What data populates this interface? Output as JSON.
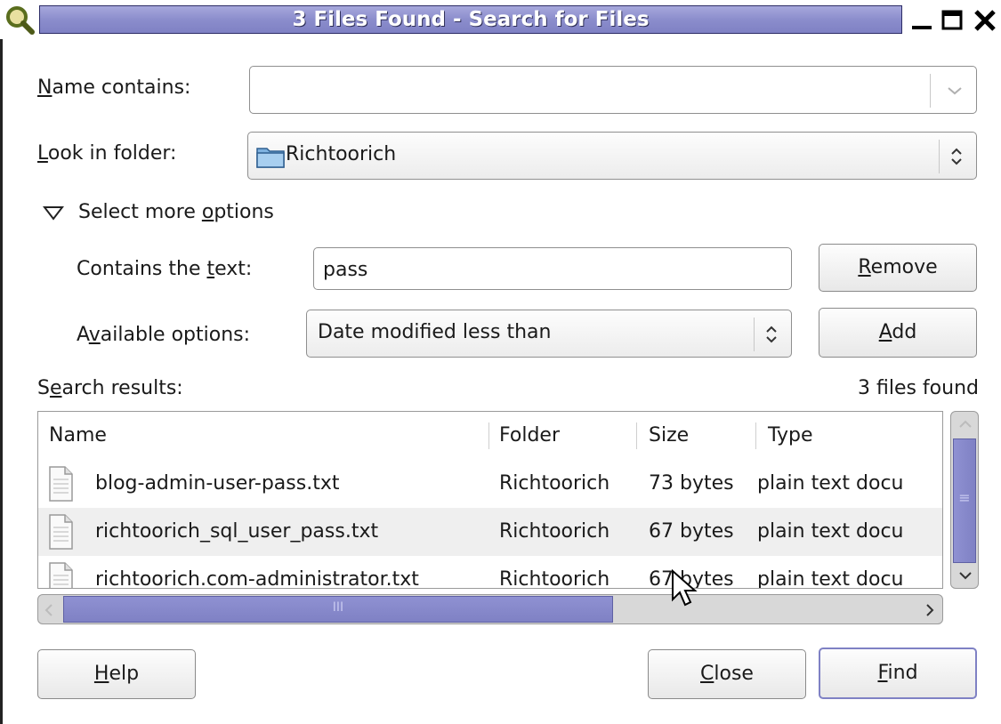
{
  "window": {
    "title": "3 Files Found - Search for Files",
    "app_icon": "magnifier-icon",
    "controls": [
      "minimize-icon",
      "maximize-icon",
      "close-icon"
    ]
  },
  "name_contains": {
    "label": "Name contains:",
    "mnemonic": "N",
    "rest": "ame contains:",
    "value": ""
  },
  "look_in": {
    "label_prefix": "",
    "mnemonic": "L",
    "rest": "ook in folder:",
    "value": "Richtoorich",
    "icon": "folder-icon"
  },
  "more_options": {
    "label_prefix": "Select more ",
    "mnemonic": "o",
    "rest": "ptions",
    "expanded": true
  },
  "contains_text": {
    "prefix": "Contains the ",
    "mnemonic": "t",
    "rest": "ext:",
    "value": "pass"
  },
  "available_options": {
    "prefix": "A",
    "mnemonic": "v",
    "rest": "ailable options:",
    "selected": "Date modified less than"
  },
  "buttons": {
    "remove": {
      "mnemonic": "R",
      "rest": "emove"
    },
    "add": {
      "mnemonic": "A",
      "rest": "dd"
    },
    "help": {
      "mnemonic": "H",
      "rest": "elp"
    },
    "close": {
      "mnemonic": "C",
      "rest": "lose"
    },
    "find": {
      "mnemonic": "F",
      "rest": "ind"
    }
  },
  "results": {
    "label_prefix": "S",
    "mnemonic": "e",
    "rest": "arch results:",
    "count_text": "3 files found",
    "columns": [
      "Name",
      "Folder",
      "Size",
      "Type"
    ],
    "rows": [
      {
        "name": "blog-admin-user-pass.txt",
        "folder": "Richtoorich",
        "size": "73 bytes",
        "type": "plain text docu"
      },
      {
        "name": "richtoorich_sql_user_pass.txt",
        "folder": "Richtoorich",
        "size": "67 bytes",
        "type": "plain text docu"
      },
      {
        "name": "richtoorich.com-administrator.txt",
        "folder": "Richtoorich",
        "size": "67 bytes",
        "type": "plain text docu"
      }
    ],
    "hscroll_grip": "III",
    "vscroll_grip": "≡"
  },
  "colors": {
    "accent": "#7f81c4",
    "title_text": "#ffffff",
    "row_alt": "#efefef"
  }
}
